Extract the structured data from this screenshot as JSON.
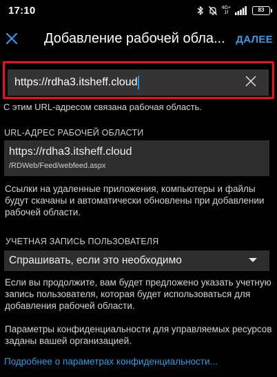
{
  "status_bar": {
    "time": "17:10",
    "network_label_top": "4G+",
    "network_label_bottom": "1f",
    "battery_level": "83"
  },
  "app_bar": {
    "title": "Добавление рабочей обла...",
    "next_label": "ДАЛЕЕ"
  },
  "url_input": {
    "value": "https://rdha3.itsheff.cloud"
  },
  "helper_text": "С этим URL-адресом связана рабочая область.",
  "workspace": {
    "section_label": "URL-АДРЕС РАБОЧЕЙ ОБЛАСТИ",
    "url": "https://rdha3.itsheff.cloud",
    "path": "/RDWeb/Feed/webfeed.aspx"
  },
  "workspace_description": "Ссылки на удаленные приложения, компьютеры и файлы будут скачаны и автоматически обновлены при добавлении рабочей области.",
  "account": {
    "section_label": "УЧЕТНАЯ ЗАПИСЬ ПОЛЬЗОВАТЕЛЯ",
    "selected": "Спрашивать, если это необходимо"
  },
  "account_description": "Если вы продолжите, вам будет предложено указать учетную запись пользователя, которая будет использоваться для добавления рабочей области.",
  "privacy_description": "Параметры конфиденциальности для управляемых ресурсов заданы вашей организацией.",
  "privacy_link": "Подробнее о параметрах конфиденциальности...",
  "colors": {
    "accent": "#3a9ae3",
    "highlight_border": "#e8131c",
    "field_background": "#2e2e2e",
    "input_background": "#343434"
  },
  "icons": {
    "close": "close-icon",
    "clear": "clear-icon",
    "dropdown": "chevron-down-icon",
    "bluetooth": "bluetooth-icon",
    "mute": "bell-off-icon",
    "signal": "signal-icon",
    "battery": "battery-icon"
  }
}
